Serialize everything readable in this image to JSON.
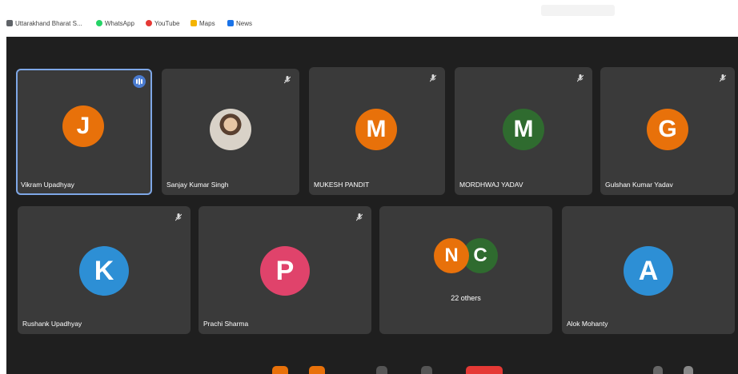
{
  "bookmarks": [
    {
      "label": "Uttarakhand Bharat S...",
      "icon": "apps-grid-icon"
    },
    {
      "label": "WhatsApp",
      "icon": "whatsapp-icon"
    },
    {
      "label": "YouTube",
      "icon": "youtube-icon"
    },
    {
      "label": "Maps",
      "icon": "maps-icon"
    },
    {
      "label": "News",
      "icon": "news-icon"
    }
  ],
  "colors": {
    "stage_bg": "#1f1f1f",
    "tile_bg": "#3a3a3a",
    "active_border": "#7ea7e6",
    "orange": "#e8710a",
    "green": "#2f6b2f",
    "blue": "#2d8fd5",
    "pink": "#e0436b"
  },
  "participants": [
    {
      "name": "Vikram Upadhyay",
      "initial": "J",
      "color": "#e8710a",
      "speaking": true
    },
    {
      "name": "Sanjay Kumar Singh",
      "initial": "",
      "photo": true,
      "muted": true
    },
    {
      "name": "MUKESH PANDIT",
      "initial": "M",
      "color": "#e8710a",
      "muted": true
    },
    {
      "name": "MORDHWAJ YADAV",
      "initial": "M",
      "color": "#2f6b2f",
      "muted": true
    },
    {
      "name": "Gulshan Kumar Yadav",
      "initial": "G",
      "color": "#e8710a",
      "muted": true
    },
    {
      "name": "Rushank Upadhyay",
      "initial": "K",
      "color": "#2d8fd5",
      "muted": true
    },
    {
      "name": "Prachi Sharma",
      "initial": "P",
      "color": "#e0436b",
      "muted": true
    },
    {
      "name": "22 others",
      "initials": [
        "N",
        "C"
      ],
      "colors": [
        "#e8710a",
        "#2f6b2f"
      ]
    },
    {
      "name": "Alok Mohanty",
      "initial": "A",
      "color": "#2d8fd5"
    }
  ]
}
